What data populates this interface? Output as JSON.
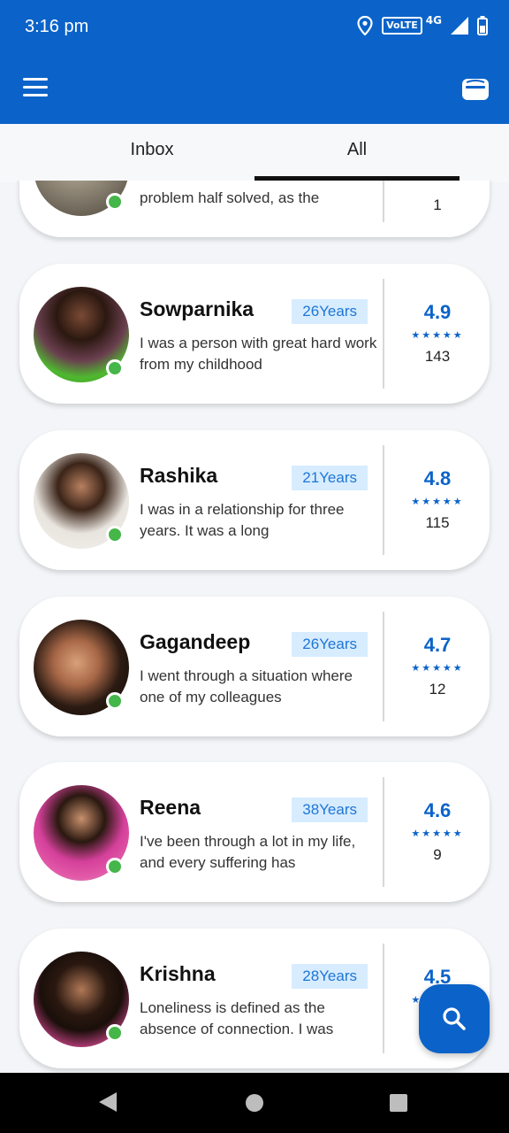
{
  "status_bar": {
    "time": "3:16 pm",
    "volte": "VoLTE",
    "network": "4G"
  },
  "colors": {
    "primary": "#0b63c9",
    "badge_bg": "#d7ecff",
    "online": "#45b649"
  },
  "icons": {
    "menu": "hamburger-menu-icon",
    "wallet": "wallet-icon",
    "search": "search-icon"
  },
  "tabs": [
    {
      "label": "Inbox"
    },
    {
      "label": "All"
    }
  ],
  "active_tab": "All",
  "partial_card": {
    "desc": "problem half solved, as the",
    "count": "1"
  },
  "cards": [
    {
      "name": "Sowparnika",
      "age": "26Years",
      "desc": "I was a person with great hard work from my childhood",
      "rating": "4.9",
      "stars": "★★★★★",
      "count": "143"
    },
    {
      "name": "Rashika",
      "age": "21Years",
      "desc": "I was in a relationship for three years. It was a long",
      "rating": "4.8",
      "stars": "★★★★★",
      "count": "115"
    },
    {
      "name": "Gagandeep",
      "age": "26Years",
      "desc": "I went through a situation where one of my colleagues",
      "rating": "4.7",
      "stars": "★★★★★",
      "count": "12"
    },
    {
      "name": "Reena",
      "age": "38Years",
      "desc": "I've been through a lot in my life, and every suffering has",
      "rating": "4.6",
      "stars": "★★★★★",
      "count": "9"
    },
    {
      "name": "Krishna",
      "age": "28Years",
      "desc": "Loneliness is defined as the absence of connection. I was",
      "rating": "4.5",
      "stars": "★★★★★",
      "count": ""
    }
  ]
}
